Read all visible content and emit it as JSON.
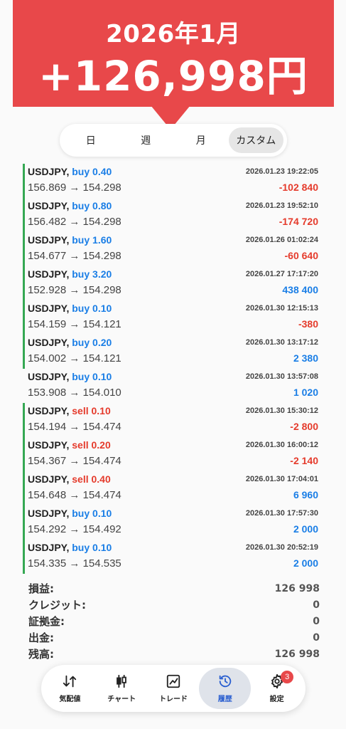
{
  "banner": {
    "month": "2026年1月",
    "amount": "+126,998円",
    "color": "#e8484a"
  },
  "period_tabs": [
    {
      "label": "日",
      "active": false
    },
    {
      "label": "週",
      "active": false
    },
    {
      "label": "月",
      "active": false
    },
    {
      "label": "カスタム",
      "active": true
    }
  ],
  "trades": [
    {
      "symbol": "USDJPY,",
      "side": "buy",
      "volume": "0.40",
      "prices": "156.869 → 154.298",
      "time": "2026.01.23 19:22:05",
      "profit": "-102 840",
      "sign": "neg",
      "bar": true
    },
    {
      "symbol": "USDJPY,",
      "side": "buy",
      "volume": "0.80",
      "prices": "156.482 → 154.298",
      "time": "2026.01.23 19:52:10",
      "profit": "-174 720",
      "sign": "neg",
      "bar": true
    },
    {
      "symbol": "USDJPY,",
      "side": "buy",
      "volume": "1.60",
      "prices": "154.677 → 154.298",
      "time": "2026.01.26 01:02:24",
      "profit": "-60 640",
      "sign": "neg",
      "bar": true
    },
    {
      "symbol": "USDJPY,",
      "side": "buy",
      "volume": "3.20",
      "prices": "152.928 → 154.298",
      "time": "2026.01.27 17:17:20",
      "profit": "438 400",
      "sign": "pos",
      "bar": true
    },
    {
      "symbol": "USDJPY,",
      "side": "buy",
      "volume": "0.10",
      "prices": "154.159 → 154.121",
      "time": "2026.01.30 12:15:13",
      "profit": "-380",
      "sign": "neg",
      "bar": true
    },
    {
      "symbol": "USDJPY,",
      "side": "buy",
      "volume": "0.20",
      "prices": "154.002 → 154.121",
      "time": "2026.01.30 13:17:12",
      "profit": "2 380",
      "sign": "pos",
      "bar": true
    },
    {
      "symbol": "USDJPY,",
      "side": "buy",
      "volume": "0.10",
      "prices": "153.908 → 154.010",
      "time": "2026.01.30 13:57:08",
      "profit": "1 020",
      "sign": "pos",
      "bar": false
    },
    {
      "symbol": "USDJPY,",
      "side": "sell",
      "volume": "0.10",
      "prices": "154.194 → 154.474",
      "time": "2026.01.30 15:30:12",
      "profit": "-2 800",
      "sign": "neg",
      "bar": true
    },
    {
      "symbol": "USDJPY,",
      "side": "sell",
      "volume": "0.20",
      "prices": "154.367 → 154.474",
      "time": "2026.01.30 16:00:12",
      "profit": "-2 140",
      "sign": "neg",
      "bar": true
    },
    {
      "symbol": "USDJPY,",
      "side": "sell",
      "volume": "0.40",
      "prices": "154.648 → 154.474",
      "time": "2026.01.30 17:04:01",
      "profit": "6 960",
      "sign": "pos",
      "bar": true
    },
    {
      "symbol": "USDJPY,",
      "side": "buy",
      "volume": "0.10",
      "prices": "154.292 → 154.492",
      "time": "2026.01.30 17:57:30",
      "profit": "2 000",
      "sign": "pos",
      "bar": true
    },
    {
      "symbol": "USDJPY,",
      "side": "buy",
      "volume": "0.10",
      "prices": "154.335 → 154.535",
      "time": "2026.01.30 20:52:19",
      "profit": "2 000",
      "sign": "pos",
      "bar": true
    }
  ],
  "summary": [
    {
      "label": "損益:",
      "value": "126 998"
    },
    {
      "label": "クレジット:",
      "value": "0"
    },
    {
      "label": "証拠金:",
      "value": "0"
    },
    {
      "label": "出金:",
      "value": "0"
    },
    {
      "label": "残高:",
      "value": "126 998"
    }
  ],
  "nav": [
    {
      "label": "気配値",
      "icon": "quotes-icon",
      "active": false
    },
    {
      "label": "チャート",
      "icon": "chart-icon",
      "active": false
    },
    {
      "label": "トレード",
      "icon": "trade-icon",
      "active": false
    },
    {
      "label": "履歴",
      "icon": "history-icon",
      "active": true
    },
    {
      "label": "設定",
      "icon": "settings-icon",
      "active": false,
      "badge": "3"
    }
  ],
  "colors": {
    "buy": "#1a7ee6",
    "sell": "#e53b2c",
    "bar": "#35a853",
    "active_nav": "#2a5fd0"
  }
}
